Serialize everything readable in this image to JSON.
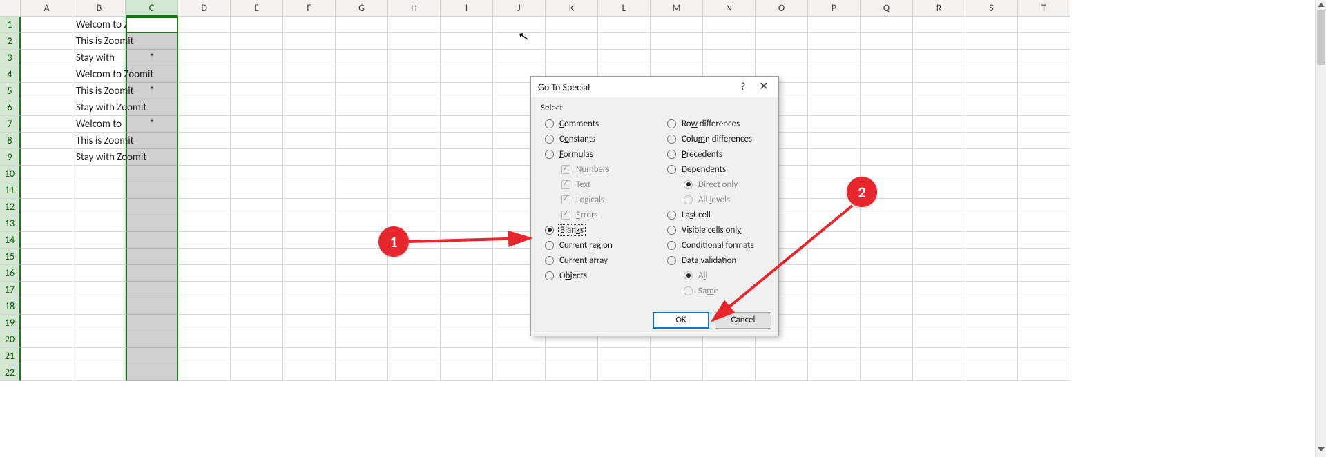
{
  "columns": [
    "A",
    "B",
    "C",
    "D",
    "E",
    "F",
    "G",
    "H",
    "I",
    "J",
    "K",
    "L",
    "M",
    "N",
    "O",
    "P",
    "Q",
    "R",
    "S",
    "T"
  ],
  "active_column_index": 2,
  "row_count": 22,
  "active_cell": "C1",
  "selection_column": "C",
  "cells": {
    "B1": "Welcom to Zoomit",
    "B2": "This is Zoomit",
    "B3": "Stay with",
    "C3": "*",
    "B4": "Welcom to Zoomit",
    "B5": "This is Zoomit",
    "C5": "*",
    "B6": "Stay with Zoomit",
    "B7": "Welcom to",
    "C7": "*",
    "B8": "This is Zoomit",
    "B9": "Stay with Zoomit"
  },
  "dialog": {
    "title": "Go To Special",
    "section": "Select",
    "selected": "blanks",
    "left": [
      {
        "key": "comments",
        "label_pre": "",
        "u": "C",
        "label_post": "omments"
      },
      {
        "key": "constants",
        "label_pre": "C",
        "u": "o",
        "label_post": "nstants"
      },
      {
        "key": "formulas",
        "label_pre": "",
        "u": "F",
        "label_post": "ormulas"
      },
      {
        "key": "numbers",
        "label_pre": "N",
        "u": "u",
        "label_post": "mbers",
        "sub": true,
        "check": true,
        "disabled": true,
        "checked": true
      },
      {
        "key": "text",
        "label_pre": "Te",
        "u": "x",
        "label_post": "t",
        "sub": true,
        "check": true,
        "disabled": true,
        "checked": true
      },
      {
        "key": "logicals",
        "label_pre": "Lo",
        "u": "g",
        "label_post": "icals",
        "sub": true,
        "check": true,
        "disabled": true,
        "checked": true
      },
      {
        "key": "errors",
        "label_pre": "",
        "u": "E",
        "label_post": "rrors",
        "sub": true,
        "check": true,
        "disabled": true,
        "checked": true
      },
      {
        "key": "blanks",
        "label_pre": "Blan",
        "u": "k",
        "label_post": "s",
        "focus": true
      },
      {
        "key": "current_region",
        "label_pre": "Current ",
        "u": "r",
        "label_post": "egion"
      },
      {
        "key": "current_array",
        "label_pre": "Current ",
        "u": "a",
        "label_post": "rray"
      },
      {
        "key": "objects",
        "label_pre": "O",
        "u": "b",
        "label_post": "jects"
      }
    ],
    "right": [
      {
        "key": "row_diff",
        "label_pre": "Ro",
        "u": "w",
        "label_post": " differences"
      },
      {
        "key": "col_diff",
        "label_pre": "Colu",
        "u": "m",
        "label_post": "n differences"
      },
      {
        "key": "precedents",
        "label_pre": "",
        "u": "P",
        "label_post": "recedents"
      },
      {
        "key": "dependents",
        "label_pre": "",
        "u": "D",
        "label_post": "ependents"
      },
      {
        "key": "direct",
        "label_pre": "D",
        "u": "i",
        "label_post": "rect only",
        "sub": true,
        "disabled": true,
        "radio_sm": true,
        "checked": true
      },
      {
        "key": "all_levels",
        "label_pre": "All ",
        "u": "l",
        "label_post": "evels",
        "sub": true,
        "disabled": true,
        "radio_sm": true
      },
      {
        "key": "last_cell",
        "label_pre": "La",
        "u": "s",
        "label_post": "t cell"
      },
      {
        "key": "visible",
        "label_pre": "Visible cells onl",
        "u": "y",
        "label_post": ""
      },
      {
        "key": "cond_fmt",
        "label_pre": "Conditional forma",
        "u": "t",
        "label_post": "s"
      },
      {
        "key": "data_val",
        "label_pre": "Data ",
        "u": "v",
        "label_post": "alidation"
      },
      {
        "key": "all",
        "label_pre": "A",
        "u": "l",
        "label_post": "l",
        "sub": true,
        "disabled": true,
        "radio_sm": true,
        "checked": true
      },
      {
        "key": "same",
        "label_pre": "Sa",
        "u": "m",
        "label_post": "e",
        "sub": true,
        "disabled": true,
        "radio_sm": true
      }
    ],
    "ok": "OK",
    "cancel": "Cancel"
  },
  "annotations": {
    "one": "1",
    "two": "2"
  }
}
